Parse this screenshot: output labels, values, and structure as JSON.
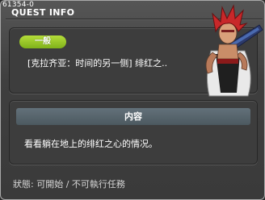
{
  "window": {
    "quest_id": "61354-0",
    "title": "QUEST INFO"
  },
  "quest": {
    "category_badge": "一般",
    "title": "[克拉齐亚：时间的另一侧] 绯红之.."
  },
  "content": {
    "header": "内容",
    "description": "看看躺在地上的绯红之心的情况。"
  },
  "status": {
    "text": "狀態: 可開始 / 不可執行任務"
  },
  "colors": {
    "badge_green": "#9acb2a",
    "content_header": "#58656d",
    "panel_bg": "#3d3d3d"
  },
  "icons": {
    "character": "red-haired-warrior-with-greatsword"
  }
}
